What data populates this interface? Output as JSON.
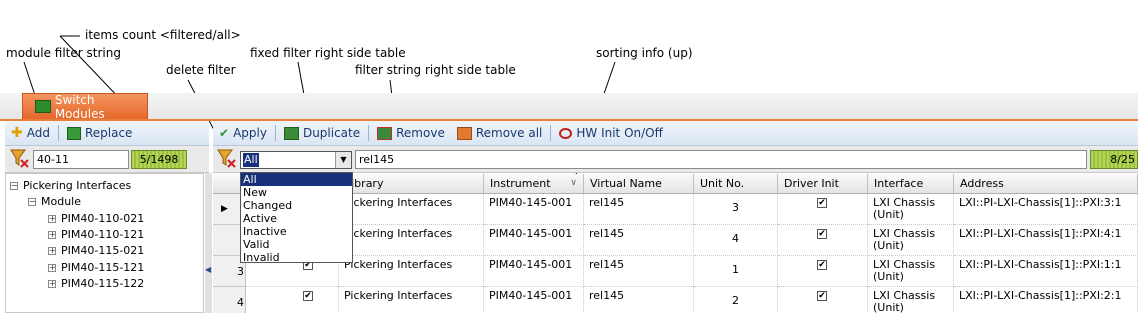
{
  "callouts": {
    "items_count": "items count <filtered/all>",
    "module_filter": "module filter string",
    "fixed_filter": "fixed filter right side table",
    "delete_filter": "delete filter",
    "filter_string": "filter string right side table",
    "sorting_info": "sorting info (up)"
  },
  "tab": {
    "label": "Switch Modules"
  },
  "left_toolbar": {
    "add": "Add",
    "replace": "Replace"
  },
  "right_toolbar": {
    "apply": "Apply",
    "duplicate": "Duplicate",
    "remove": "Remove",
    "remove_all": "Remove all",
    "hw_init": "HW Init On/Off"
  },
  "left_filter": {
    "value": "40-11",
    "count": "5/1498"
  },
  "right_filter": {
    "selected": "All",
    "value": "rel145",
    "count": "8/25"
  },
  "dropdown_options": [
    "All",
    "New",
    "Changed",
    "Active",
    "Inactive",
    "Valid",
    "Invalid"
  ],
  "tree": {
    "root": "Pickering Interfaces",
    "group": "Module",
    "items": [
      "PIM40-110-021",
      "PIM40-110-121",
      "PIM40-115-021",
      "PIM40-115-121",
      "PIM40-115-122"
    ]
  },
  "columns": [
    "Library",
    "Instrument",
    "Virtual Name",
    "Unit No.",
    "Driver Init",
    "Interface",
    "Address"
  ],
  "rows": [
    {
      "num": "",
      "library": "Pickering Interfaces",
      "instrument": "PIM40-145-001",
      "virtual": "rel145",
      "unit": "3",
      "iface1": "LXI Chassis",
      "iface2": "(Unit)",
      "address": "LXI::PI-LXI-Chassis[1]::PXI:3:1"
    },
    {
      "num": "",
      "library": "Pickering Interfaces",
      "instrument": "PIM40-145-001",
      "virtual": "rel145",
      "unit": "4",
      "iface1": "LXI Chassis",
      "iface2": "(Unit)",
      "address": "LXI::PI-LXI-Chassis[1]::PXI:4:1"
    },
    {
      "num": "3",
      "library": "Pickering Interfaces",
      "instrument": "PIM40-145-001",
      "virtual": "rel145",
      "unit": "1",
      "iface1": "LXI Chassis",
      "iface2": "(Unit)",
      "address": "LXI::PI-LXI-Chassis[1]::PXI:1:1"
    },
    {
      "num": "4",
      "library": "Pickering Interfaces",
      "instrument": "PIM40-145-001",
      "virtual": "rel145",
      "unit": "2",
      "iface1": "LXI Chassis",
      "iface2": "(Unit)",
      "address": "LXI::PI-LXI-Chassis[1]::PXI:2:1"
    }
  ]
}
